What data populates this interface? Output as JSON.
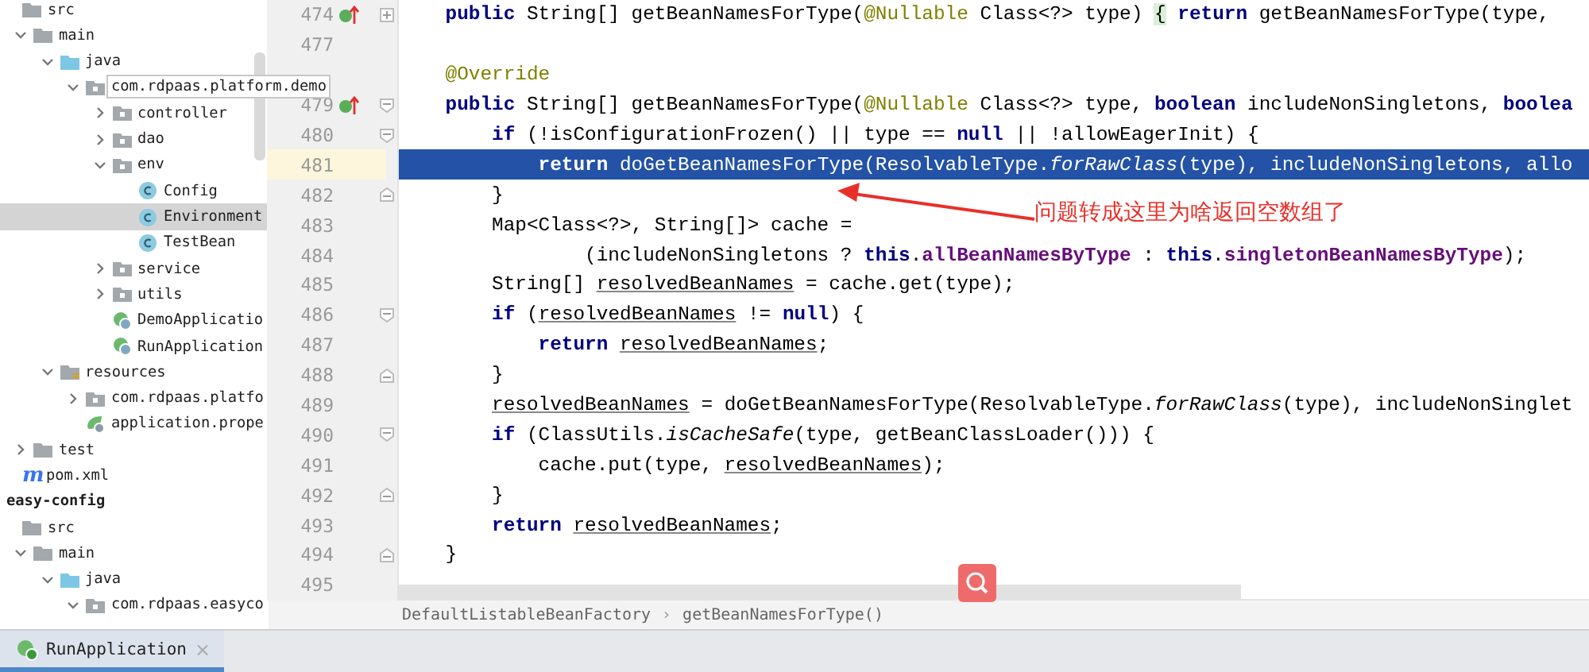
{
  "project_tree": [
    {
      "label": "src",
      "kind": "folder",
      "selected": false,
      "children": [
        {
          "label": "main",
          "kind": "folder",
          "expanded": true,
          "selected": false,
          "children": [
            {
              "label": "java",
              "kind": "source-folder",
              "expanded": true,
              "selected": false,
              "children": [
                {
                  "label": "com.rdpaas.platform.demo",
                  "kind": "package",
                  "expanded": true,
                  "selected": false,
                  "tooltip": true,
                  "children": [
                    {
                      "label": "controller",
                      "kind": "package",
                      "expanded": false,
                      "selected": false
                    },
                    {
                      "label": "dao",
                      "kind": "package",
                      "expanded": false,
                      "selected": false
                    },
                    {
                      "label": "env",
                      "kind": "package",
                      "expanded": true,
                      "selected": false,
                      "children": [
                        {
                          "label": "Config",
                          "kind": "class",
                          "selected": false
                        },
                        {
                          "label": "Environment",
                          "kind": "class",
                          "selected": true
                        },
                        {
                          "label": "TestBean",
                          "kind": "class",
                          "selected": false
                        }
                      ]
                    },
                    {
                      "label": "service",
                      "kind": "package",
                      "expanded": false,
                      "selected": false
                    },
                    {
                      "label": "utils",
                      "kind": "package",
                      "expanded": false,
                      "selected": false
                    },
                    {
                      "label": "DemoApplicatio",
                      "kind": "spring-app",
                      "selected": false
                    },
                    {
                      "label": "RunApplication",
                      "kind": "spring-app",
                      "selected": false
                    }
                  ]
                }
              ]
            },
            {
              "label": "resources",
              "kind": "resources-folder",
              "expanded": true,
              "selected": false,
              "children": [
                {
                  "label": "com.rdpaas.platfo",
                  "kind": "package",
                  "expanded": false,
                  "selected": false
                },
                {
                  "label": "application.prope",
                  "kind": "properties",
                  "selected": false
                }
              ]
            }
          ]
        },
        {
          "label": "test",
          "kind": "folder",
          "expanded": false,
          "selected": false
        }
      ]
    },
    {
      "label": "pom.xml",
      "kind": "maven",
      "icon_text": "m",
      "selected": false
    },
    {
      "label": "easy-config",
      "kind": "module",
      "selected": false,
      "children": [
        {
          "label": "src",
          "kind": "folder",
          "selected": false,
          "children": [
            {
              "label": "main",
              "kind": "folder",
              "expanded": true,
              "selected": false,
              "children": [
                {
                  "label": "java",
                  "kind": "source-folder",
                  "expanded": true,
                  "selected": false,
                  "children": [
                    {
                      "label": "com.rdpaas.easyco",
                      "kind": "package",
                      "expanded": true,
                      "selected": false
                    }
                  ]
                }
              ]
            }
          ]
        }
      ]
    }
  ],
  "editor": {
    "lines": [
      {
        "number": "474",
        "overrides": true,
        "fold": {
          "kind": "collapsed"
        },
        "selected": false,
        "tokens": [
          {
            "kind": "kw",
            "text": "    public"
          },
          {
            "kind": "plain",
            "text": " String[] getBeanNamesForType("
          },
          {
            "kind": "annotation",
            "text": "@Nullable"
          },
          {
            "kind": "plain",
            "text": " Class<?> type) "
          },
          {
            "kind": "match",
            "text": "{"
          },
          {
            "kind": "kw",
            "text": " return"
          },
          {
            "kind": "plain",
            "text": " getBeanNamesForType(type,"
          }
        ]
      },
      {
        "number": "477",
        "selected": false
      },
      {
        "selected": false,
        "tokens": [
          {
            "kind": "annotation",
            "text": "    @Override"
          }
        ]
      },
      {
        "number": "479",
        "overrides": true,
        "fold": {
          "kind": "open"
        },
        "selected": false,
        "tokens": [
          {
            "kind": "kw",
            "text": "    public"
          },
          {
            "kind": "plain",
            "text": " String[] getBeanNamesForType("
          },
          {
            "kind": "annotation",
            "text": "@Nullable"
          },
          {
            "kind": "plain",
            "text": " Class<?> type, "
          },
          {
            "kind": "kw",
            "text": "boolean"
          },
          {
            "kind": "plain",
            "text": " includeNonSingletons, "
          },
          {
            "kind": "kw",
            "text": "boolea"
          }
        ]
      },
      {
        "number": "480",
        "fold": {
          "kind": "open"
        },
        "selected": false,
        "tokens": [
          {
            "kind": "kw",
            "text": "        if"
          },
          {
            "kind": "plain",
            "text": " (!isConfigurationFrozen() || type == "
          },
          {
            "kind": "kw",
            "text": "null"
          },
          {
            "kind": "plain",
            "text": " || !allowEagerInit) {"
          }
        ]
      },
      {
        "number": "481",
        "selected": true,
        "tokens": [
          {
            "kind": "kw",
            "text": "            return"
          },
          {
            "kind": "plain",
            "text": " doGetBeanNamesForType(ResolvableType."
          },
          {
            "kind": "static",
            "text": "forRawClass"
          },
          {
            "kind": "plain",
            "text": "(type), includeNonSingletons, allo"
          }
        ]
      },
      {
        "number": "482",
        "fold": {
          "kind": "close"
        },
        "selected": false,
        "tokens": [
          {
            "kind": "plain",
            "text": "        }"
          }
        ]
      },
      {
        "number": "483",
        "selected": false,
        "tokens": [
          {
            "kind": "plain",
            "text": "        Map<Class<?>, String[]> cache ="
          }
        ]
      },
      {
        "number": "484",
        "selected": false,
        "tokens": [
          {
            "kind": "plain",
            "text": "                (includeNonSingletons ? "
          },
          {
            "kind": "kw",
            "text": "this"
          },
          {
            "kind": "plain",
            "text": "."
          },
          {
            "kind": "field",
            "text": "allBeanNamesByType"
          },
          {
            "kind": "plain",
            "text": " : "
          },
          {
            "kind": "kw",
            "text": "this"
          },
          {
            "kind": "plain",
            "text": "."
          },
          {
            "kind": "field",
            "text": "singletonBeanNamesByType"
          },
          {
            "kind": "plain",
            "text": ");"
          }
        ]
      },
      {
        "number": "485",
        "selected": false,
        "tokens": [
          {
            "kind": "plain",
            "text": "        String[] "
          },
          {
            "kind": "var",
            "text": "resolvedBeanNames"
          },
          {
            "kind": "plain",
            "text": " = cache.get(type);"
          }
        ]
      },
      {
        "number": "486",
        "fold": {
          "kind": "open"
        },
        "selected": false,
        "tokens": [
          {
            "kind": "kw",
            "text": "        if"
          },
          {
            "kind": "plain",
            "text": " ("
          },
          {
            "kind": "var",
            "text": "resolvedBeanNames"
          },
          {
            "kind": "plain",
            "text": " != "
          },
          {
            "kind": "kw",
            "text": "null"
          },
          {
            "kind": "plain",
            "text": ") {"
          }
        ]
      },
      {
        "number": "487",
        "selected": false,
        "tokens": [
          {
            "kind": "kw",
            "text": "            return "
          },
          {
            "kind": "var",
            "text": "resolvedBeanNames"
          },
          {
            "kind": "plain",
            "text": ";"
          }
        ]
      },
      {
        "number": "488",
        "fold": {
          "kind": "close"
        },
        "selected": false,
        "tokens": [
          {
            "kind": "plain",
            "text": "        }"
          }
        ]
      },
      {
        "number": "489",
        "selected": false,
        "tokens": [
          {
            "kind": "var",
            "text": "        resolvedBeanNames"
          },
          {
            "kind": "plain",
            "text": " = doGetBeanNamesForType(ResolvableType."
          },
          {
            "kind": "static",
            "text": "forRawClass"
          },
          {
            "kind": "plain",
            "text": "(type), includeNonSinglet"
          }
        ]
      },
      {
        "number": "490",
        "fold": {
          "kind": "open"
        },
        "selected": false,
        "tokens": [
          {
            "kind": "kw",
            "text": "        if"
          },
          {
            "kind": "plain",
            "text": " (ClassUtils."
          },
          {
            "kind": "static",
            "text": "isCacheSafe"
          },
          {
            "kind": "plain",
            "text": "(type, getBeanClassLoader())) {"
          }
        ]
      },
      {
        "number": "491",
        "selected": false,
        "tokens": [
          {
            "kind": "plain",
            "text": "            cache.put(type, "
          },
          {
            "kind": "var",
            "text": "resolvedBeanNames"
          },
          {
            "kind": "plain",
            "text": ");"
          }
        ]
      },
      {
        "number": "492",
        "fold": {
          "kind": "close"
        },
        "selected": false,
        "tokens": [
          {
            "kind": "plain",
            "text": "        }"
          }
        ]
      },
      {
        "number": "493",
        "selected": false,
        "tokens": [
          {
            "kind": "kw",
            "text": "        return "
          },
          {
            "kind": "var",
            "text": "resolvedBeanNames"
          },
          {
            "kind": "plain",
            "text": ";"
          }
        ]
      },
      {
        "number": "494",
        "fold": {
          "kind": "close"
        },
        "selected": false,
        "tokens": [
          {
            "kind": "plain",
            "text": "    }"
          }
        ]
      },
      {
        "number": "495",
        "selected": false
      }
    ],
    "callout": "问题转成这里为啥返回空数组了",
    "breadcrumbs": [
      "DefaultListableBeanFactory",
      "getBeanNamesForType()"
    ],
    "breadcrumb_separator": "›"
  },
  "bottom_tabs": [
    {
      "label": "RunApplication",
      "close": "×",
      "selected": true
    }
  ]
}
